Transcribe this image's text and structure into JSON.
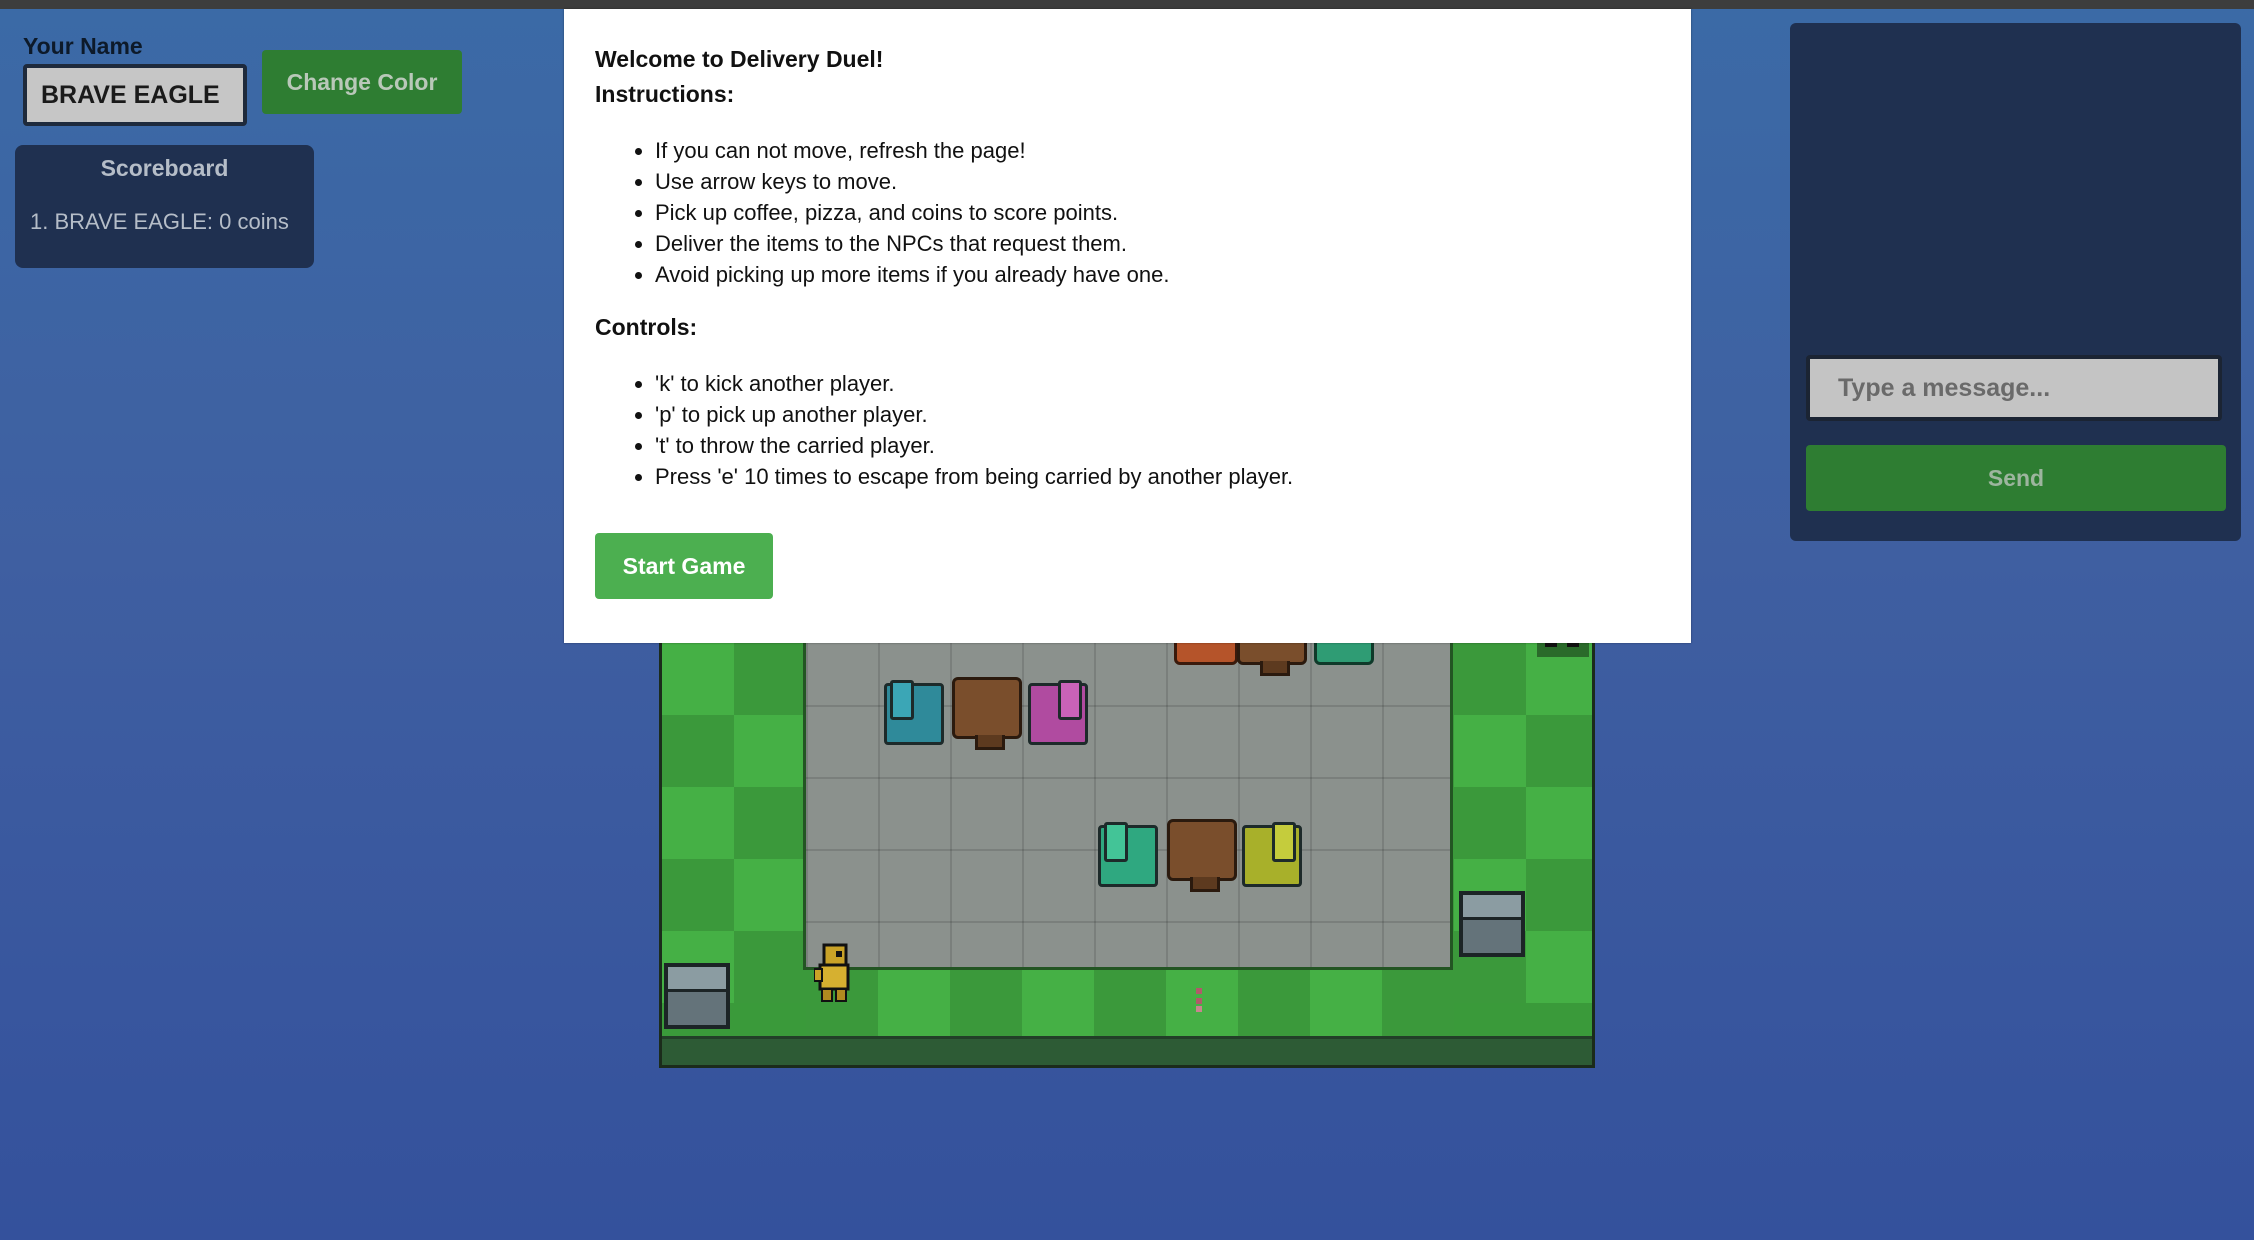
{
  "header": {
    "name_label": "Your Name",
    "name_value": "BRAVE EAGLE",
    "change_color_label": "Change Color"
  },
  "scoreboard": {
    "title": "Scoreboard",
    "entries": [
      "1. BRAVE EAGLE: 0 coins"
    ]
  },
  "chat": {
    "placeholder": "Type a message...",
    "send_label": "Send"
  },
  "modal": {
    "welcome": "Welcome to Delivery Duel!",
    "instructions_title": "Instructions:",
    "instructions": [
      "If you can not move, refresh the page!",
      "Use arrow keys to move.",
      "Pick up coffee, pizza, and coins to score points.",
      "Deliver the items to the NPCs that request them.",
      "Avoid picking up more items if you already have one."
    ],
    "controls_title": "Controls:",
    "controls": [
      "'k' to kick another player.",
      "'p' to pick up another player.",
      "'t' to throw the carried player.",
      "Press 'e' 10 times to escape from being carried by another player."
    ],
    "start_label": "Start Game"
  },
  "colors": {
    "accent_green": "#4caf50",
    "dark_green": "#2e7d32",
    "panel": "#1f3050"
  },
  "icons": {
    "player": "player-sprite-icon",
    "npc": "npc-sprite-icon"
  }
}
